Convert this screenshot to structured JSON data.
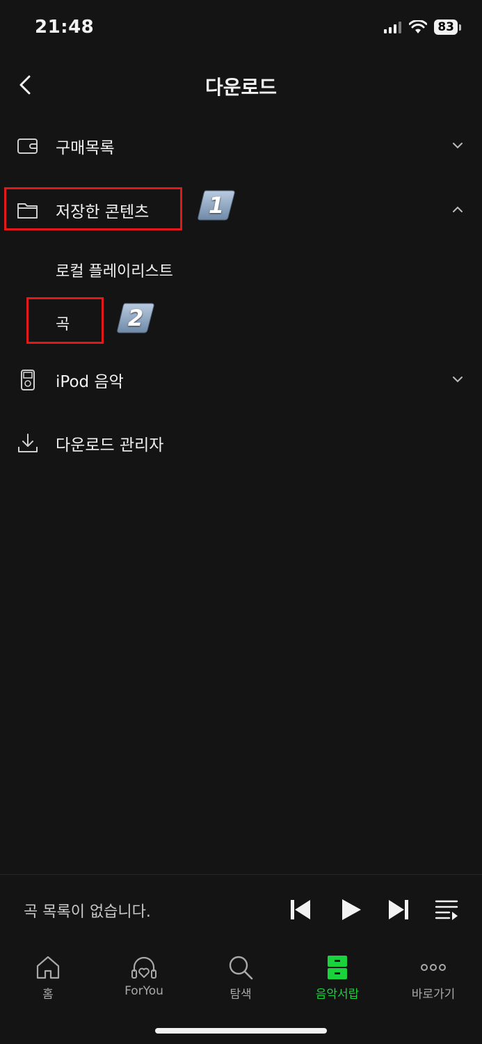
{
  "status_bar": {
    "time": "21:48",
    "battery": "83"
  },
  "header": {
    "title": "다운로드"
  },
  "menu": {
    "purchases": {
      "label": "구매목록"
    },
    "saved_content": {
      "label": "저장한 콘텐츠"
    },
    "local_playlist": {
      "label": "로컬 플레이리스트"
    },
    "songs": {
      "label": "곡"
    },
    "ipod_music": {
      "label": "iPod 음악"
    },
    "download_manager": {
      "label": "다운로드 관리자"
    }
  },
  "annotations": {
    "step1": "1",
    "step2": "2"
  },
  "player": {
    "empty_text": "곡 목록이 없습니다."
  },
  "tabs": [
    {
      "label": "홈",
      "icon": "home-icon"
    },
    {
      "label": "ForYou",
      "icon": "headphones-heart-icon"
    },
    {
      "label": "탐색",
      "icon": "search-icon"
    },
    {
      "label": "음악서랍",
      "icon": "drawer-icon",
      "active": true
    },
    {
      "label": "바로가기",
      "icon": "more-icon"
    }
  ],
  "colors": {
    "background": "#141414",
    "accent": "#19d23c",
    "highlight": "#e21919",
    "badge": "#8fa6bf"
  }
}
